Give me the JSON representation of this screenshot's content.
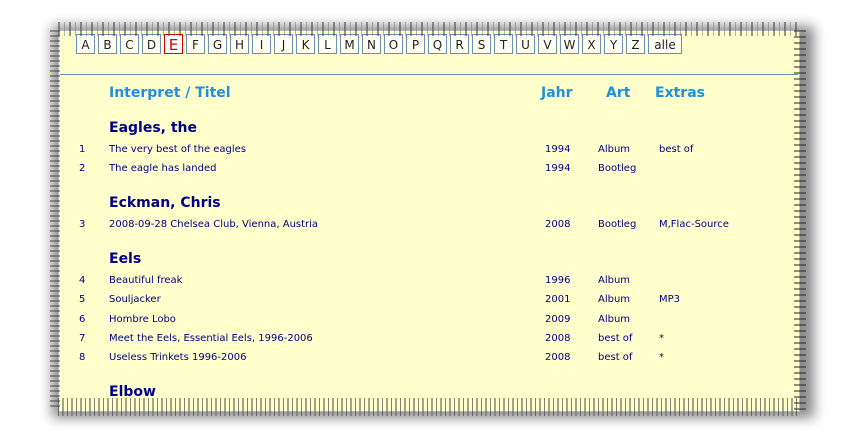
{
  "nav": {
    "letters": [
      "A",
      "B",
      "C",
      "D",
      "E",
      "F",
      "G",
      "H",
      "I",
      "J",
      "K",
      "L",
      "M",
      "N",
      "O",
      "P",
      "Q",
      "R",
      "S",
      "T",
      "U",
      "V",
      "W",
      "X",
      "Y",
      "Z",
      "alle"
    ],
    "active": "E"
  },
  "header": {
    "title_label": "Interpret / Titel",
    "year_label": "Jahr",
    "type_label": "Art",
    "extras_label": "Extras"
  },
  "groups": [
    {
      "artist": "Eagles, the",
      "rows": [
        {
          "num": "1",
          "title": "The very best of the eagles",
          "year": "1994",
          "type": "Album",
          "extra": "best of"
        },
        {
          "num": "2",
          "title": "The eagle has landed",
          "year": "1994",
          "type": "Bootleg",
          "extra": ""
        }
      ]
    },
    {
      "artist": "Eckman, Chris",
      "rows": [
        {
          "num": "3",
          "title": "2008-09-28 Chelsea Club, Vienna, Austria",
          "year": "2008",
          "type": "Bootleg",
          "extra": "M,Flac-Source"
        }
      ]
    },
    {
      "artist": "Eels",
      "rows": [
        {
          "num": "4",
          "title": "Beautiful freak",
          "year": "1996",
          "type": "Album",
          "extra": ""
        },
        {
          "num": "5",
          "title": "Souljacker",
          "year": "2001",
          "type": "Album",
          "extra": "MP3"
        },
        {
          "num": "6",
          "title": "Hombre Lobo",
          "year": "2009",
          "type": "Album",
          "extra": ""
        },
        {
          "num": "7",
          "title": "Meet the Eels, Essential Eels, 1996-2006",
          "year": "2008",
          "type": "best of",
          "extra": "*"
        },
        {
          "num": "8",
          "title": "Useless Trinkets 1996-2006",
          "year": "2008",
          "type": "best of",
          "extra": "*"
        }
      ]
    },
    {
      "artist": "Elbow",
      "rows": []
    }
  ]
}
